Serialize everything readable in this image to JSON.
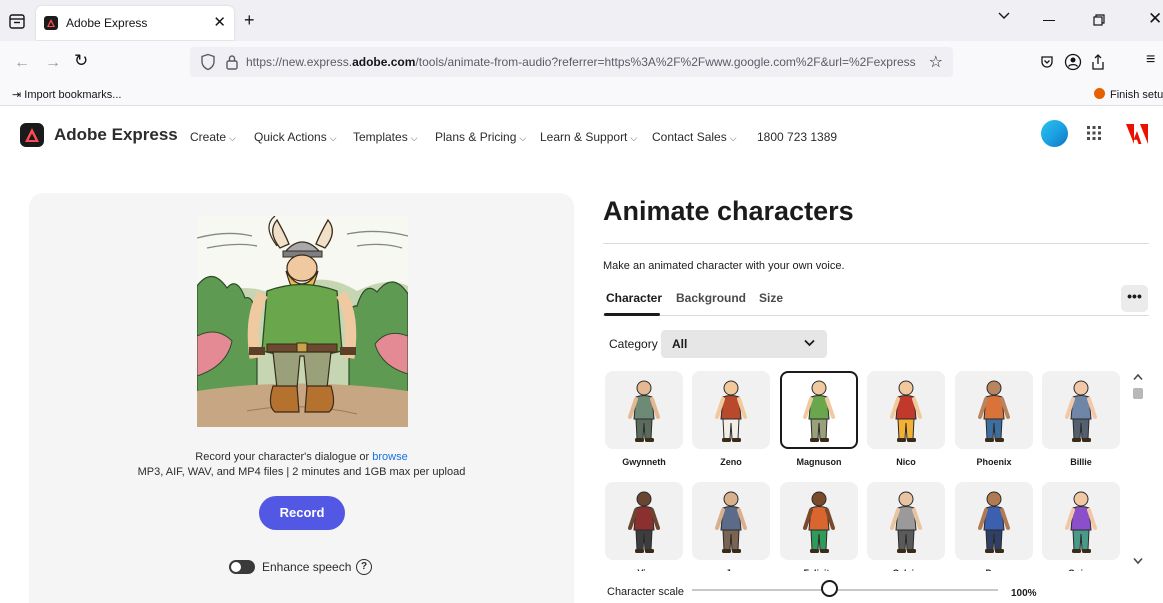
{
  "browser": {
    "tab_title": "Adobe Express",
    "url_prefix": "https://new.express.",
    "url_domain": "adobe.com",
    "url_suffix": "/tools/animate-from-audio?referrer=https%3A%2F%2Fwww.google.com%2F&url=%2Fexpress%2F",
    "bookmark_import": "Import bookmarks...",
    "bookmark_finish": "Finish setup"
  },
  "header": {
    "brand": "Adobe Express",
    "nav": [
      {
        "label": "Create"
      },
      {
        "label": "Quick Actions"
      },
      {
        "label": "Templates"
      },
      {
        "label": "Plans & Pricing"
      },
      {
        "label": "Learn & Support"
      },
      {
        "label": "Contact Sales"
      }
    ],
    "phone": "1800 723 1389"
  },
  "left": {
    "record_prompt": "Record your character's dialogue or ",
    "browse": "browse",
    "file_info": "MP3, AIF, WAV, and MP4 files | 2 minutes and 1GB max per upload",
    "record_button": "Record",
    "enhance_label": "Enhance speech",
    "enhance_on": false,
    "help_glyph": "?"
  },
  "right": {
    "title": "Animate characters",
    "subtitle": "Make an animated character with your own voice.",
    "tabs": [
      {
        "label": "Character",
        "active": true
      },
      {
        "label": "Background",
        "active": false
      },
      {
        "label": "Size",
        "active": false
      }
    ],
    "more_glyph": "•••",
    "category_label": "Category",
    "category_value": "All",
    "characters": [
      {
        "name": "Gwynneth",
        "selected": false
      },
      {
        "name": "Zeno",
        "selected": false
      },
      {
        "name": "Magnuson",
        "selected": true
      },
      {
        "name": "Nico",
        "selected": false
      },
      {
        "name": "Phoenix",
        "selected": false
      },
      {
        "name": "Billie",
        "selected": false
      },
      {
        "name": "Vic",
        "selected": false
      },
      {
        "name": "Jo",
        "selected": false
      },
      {
        "name": "Felicity",
        "selected": false
      },
      {
        "name": "Calvin",
        "selected": false
      },
      {
        "name": "Dan",
        "selected": false
      },
      {
        "name": "Quinn",
        "selected": false
      }
    ],
    "scale_label": "Character scale",
    "scale_value": "100%",
    "scale_fraction": 0.45
  },
  "colors": {
    "accent": "#5258e4",
    "link": "#1473e6",
    "panel": "#f5f5f5"
  }
}
